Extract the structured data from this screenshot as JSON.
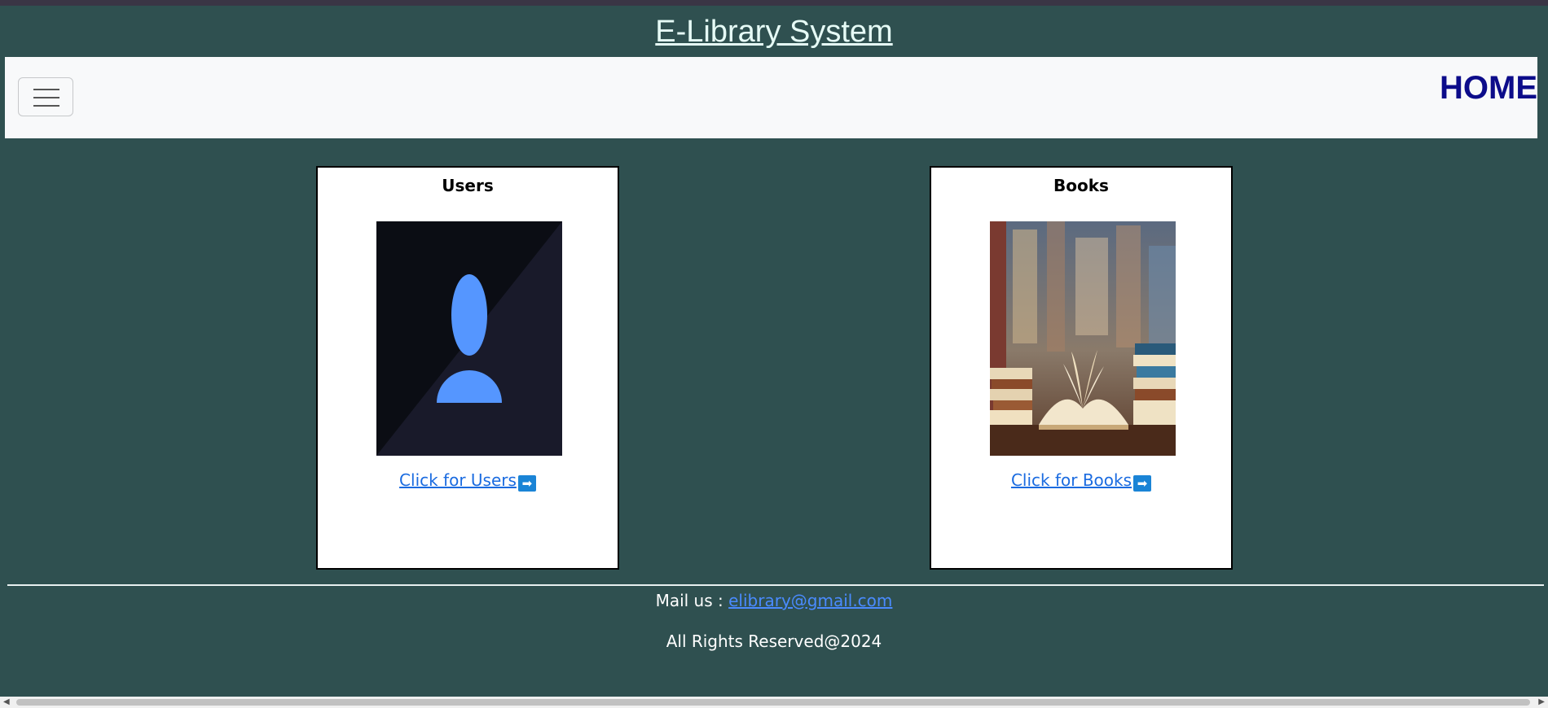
{
  "header": {
    "title": "E-Library System"
  },
  "navbar": {
    "home_label": "HOME",
    "menu_icon": "hamburger-menu-icon"
  },
  "cards": [
    {
      "title": "Users",
      "link_text": "Click for Users",
      "image": "user-avatar-image",
      "arrow_icon": "right-arrow-icon"
    },
    {
      "title": "Books",
      "link_text": "Click for Books",
      "image": "open-book-library-image",
      "arrow_icon": "right-arrow-icon"
    }
  ],
  "footer": {
    "mail_label": "Mail us :",
    "email": "elibrary@gmail.com",
    "rights": "All Rights Reserved@2024"
  },
  "colors": {
    "page_bg": "#2f5050",
    "navbar_bg": "#f8f9fa",
    "home_link": "#0c0c8a",
    "link": "#1a6be0",
    "avatar": "#5596ff"
  }
}
